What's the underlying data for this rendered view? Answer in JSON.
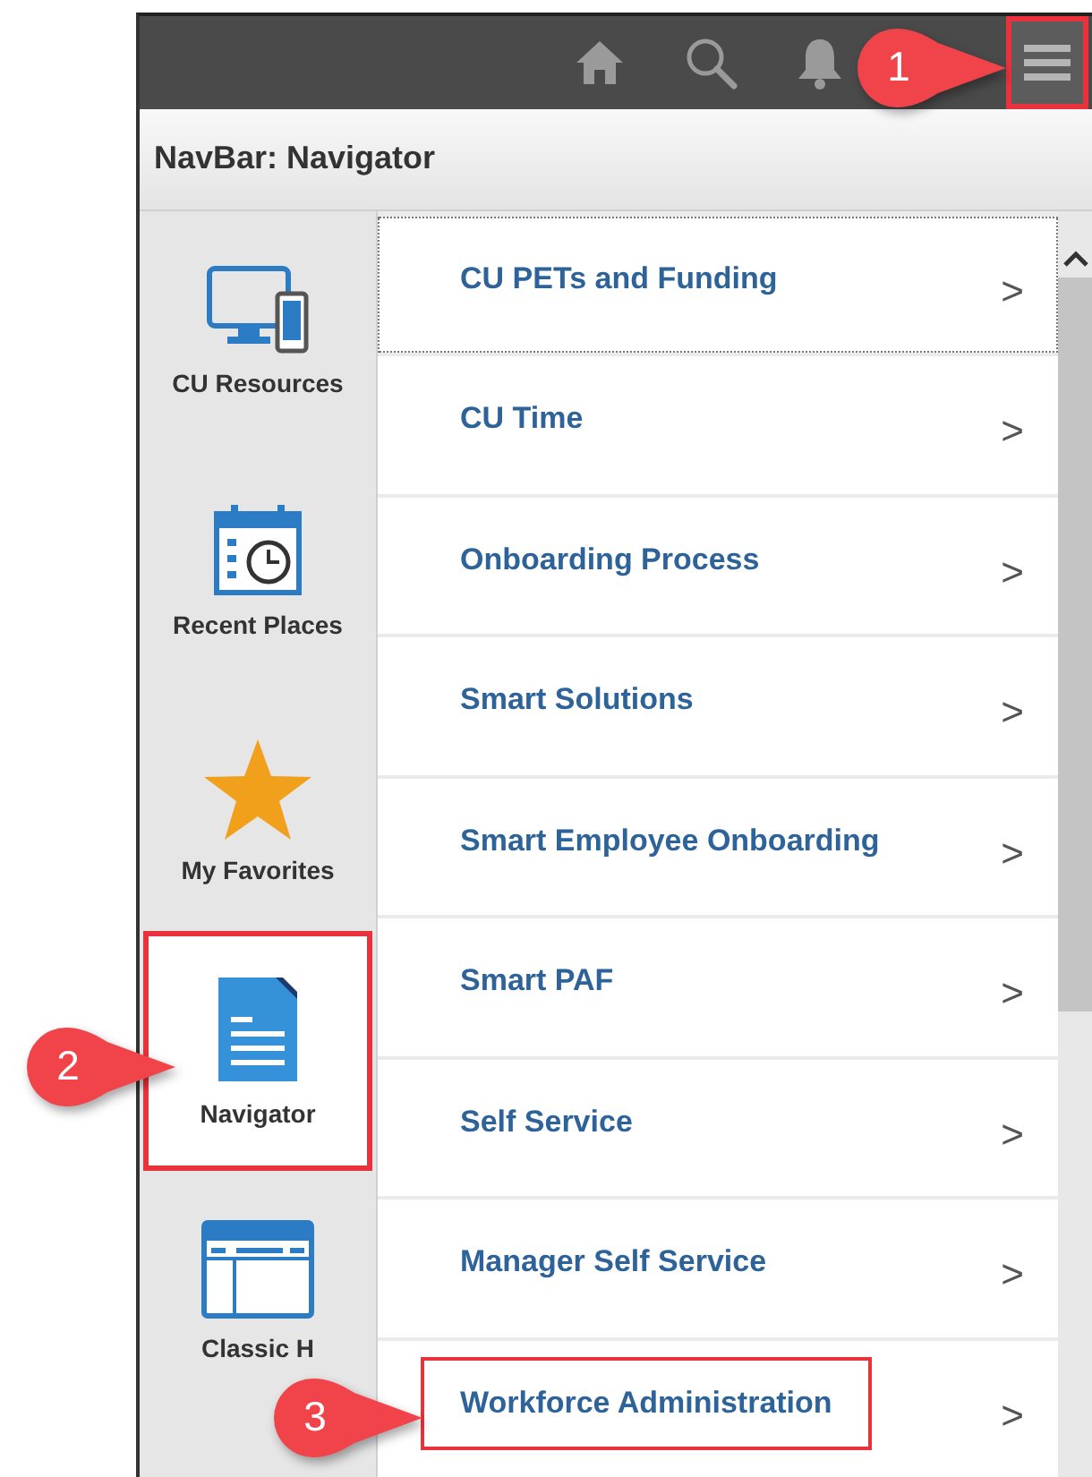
{
  "top_bar": {
    "icons": [
      {
        "kind": "home",
        "highlighted": false
      },
      {
        "kind": "search",
        "highlighted": false
      },
      {
        "kind": "bell",
        "highlighted": false
      },
      {
        "kind": "menu",
        "highlighted": true
      }
    ]
  },
  "header": {
    "title": "NavBar: Navigator"
  },
  "sidebar": {
    "items": [
      {
        "label": "CU Resources",
        "kind": "devices",
        "selected": false,
        "highlighted": false
      },
      {
        "label": "Recent Places",
        "kind": "calendar",
        "selected": false,
        "highlighted": false
      },
      {
        "label": "My Favorites",
        "kind": "star",
        "selected": false,
        "highlighted": false
      },
      {
        "label": "Navigator",
        "kind": "document",
        "selected": true,
        "highlighted": true
      },
      {
        "label": "Classic H",
        "kind": "window",
        "selected": false,
        "highlighted": false
      }
    ]
  },
  "menu": {
    "items": [
      {
        "label": "CU PETs and Funding",
        "chevron": ">",
        "focused": true,
        "highlighted": false
      },
      {
        "label": "CU Time",
        "chevron": ">",
        "focused": false,
        "highlighted": false
      },
      {
        "label": "Onboarding Process",
        "chevron": ">",
        "focused": false,
        "highlighted": false
      },
      {
        "label": "Smart Solutions",
        "chevron": ">",
        "focused": false,
        "highlighted": false
      },
      {
        "label": "Smart Employee Onboarding",
        "chevron": ">",
        "focused": false,
        "highlighted": false
      },
      {
        "label": "Smart PAF",
        "chevron": ">",
        "focused": false,
        "highlighted": false
      },
      {
        "label": "Self Service",
        "chevron": ">",
        "focused": false,
        "highlighted": false
      },
      {
        "label": "Manager Self Service",
        "chevron": ">",
        "focused": false,
        "highlighted": false
      },
      {
        "label": "Workforce Administration",
        "chevron": ">",
        "focused": false,
        "highlighted": true
      }
    ]
  },
  "callouts": [
    {
      "number": "1"
    },
    {
      "number": "2"
    },
    {
      "number": "3"
    }
  ]
}
